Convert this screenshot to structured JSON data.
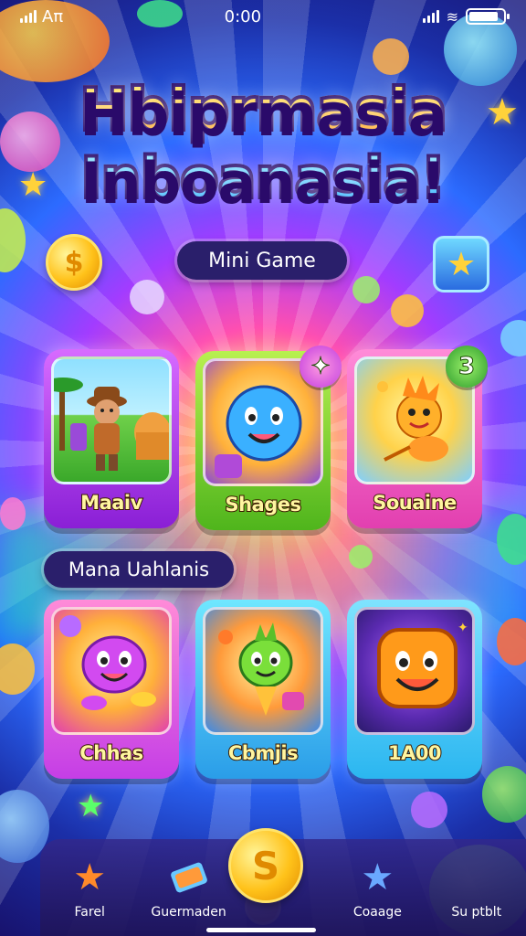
{
  "status_bar": {
    "carrier": "Aπ",
    "time": "0:00",
    "battery_level": 0.85
  },
  "title": {
    "line1": "Hbiprmasia",
    "line2": "Inboanasia!"
  },
  "section_mini_game": {
    "label": "Mini Game"
  },
  "top_cards": [
    {
      "label": "Maaiv",
      "icon": "explorer-character"
    },
    {
      "label": "Shages",
      "icon": "smiling-blue-ball",
      "badge_icon": "sparkle-icon"
    },
    {
      "label": "Souaine",
      "icon": "orange-creature",
      "badge": "3"
    }
  ],
  "section_two": {
    "label": "Mana Uahlanis"
  },
  "bottom_cards": [
    {
      "label": "Chhas",
      "icon": "pink-blob-character"
    },
    {
      "label": "Cbmjis",
      "icon": "green-creature"
    },
    {
      "label": "1A00",
      "icon": "orange-cube-character"
    }
  ],
  "nav": {
    "items": [
      {
        "label": "Farel",
        "icon": "star-icon"
      },
      {
        "label": "Guermaden",
        "icon": "ticket-icon"
      },
      {
        "label": "Coaage",
        "icon": "star-icon"
      },
      {
        "label": "Su ptblt",
        "icon": "coin-icon"
      }
    ],
    "center_icon": "coin-icon",
    "center_symbol": "S"
  },
  "colors": {
    "pill_bg": "#2a1f6b",
    "label_text": "#fff6a0",
    "coin": "#ffc21a"
  }
}
